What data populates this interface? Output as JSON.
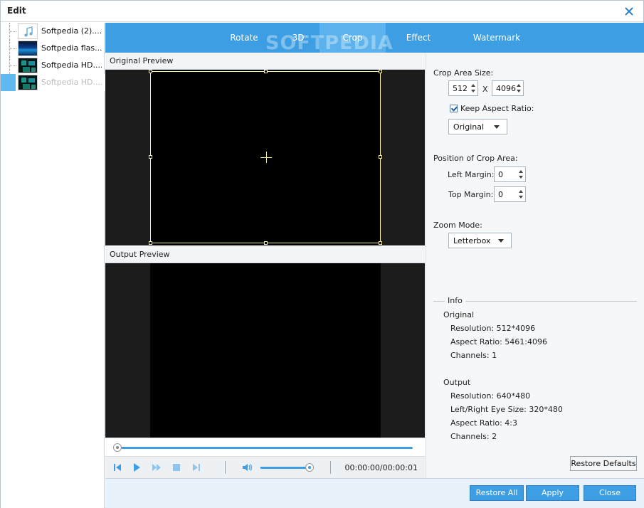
{
  "window": {
    "title": "Edit"
  },
  "files": [
    {
      "name": "Softpedia (2)....",
      "thumb": "music-note-icon"
    },
    {
      "name": "Softpedia flas...",
      "thumb": "flash-video-thumbnail"
    },
    {
      "name": "Softpedia HD....",
      "thumb": "hd-video-thumbnail"
    },
    {
      "name": "Softpedia HD....",
      "thumb": "hd-video-thumbnail",
      "selected": true
    }
  ],
  "tabs": [
    "Rotate",
    "3D",
    "Crop",
    "Effect",
    "Watermark"
  ],
  "active_tab": "Crop",
  "watermark_text": "SOFTPEDIA",
  "preview": {
    "original_label": "Original Preview",
    "output_label": "Output Preview"
  },
  "player": {
    "time": "00:00:00/00:00:01"
  },
  "crop": {
    "area_size_label": "Crop Area Size:",
    "width": "512",
    "x_label": "X",
    "height": "4096",
    "keep_aspect_label": "Keep Aspect Ratio:",
    "keep_aspect_checked": true,
    "aspect_value": "Original",
    "position_label": "Position of Crop Area:",
    "left_margin_label": "Left Margin:",
    "left_margin": "0",
    "top_margin_label": "Top Margin:",
    "top_margin": "0",
    "zoom_mode_label": "Zoom Mode:",
    "zoom_mode": "Letterbox"
  },
  "info": {
    "title": "Info",
    "original_label": "Original",
    "original_resolution": "Resolution: 512*4096",
    "original_aspect": "Aspect Ratio: 5461:4096",
    "original_channels": "Channels: 1",
    "output_label": "Output",
    "output_resolution": "Resolution: 640*480",
    "output_eye_size": "Left/Right Eye Size: 320*480",
    "output_aspect": "Aspect Ratio: 4:3",
    "output_channels": "Channels: 2"
  },
  "buttons": {
    "restore_defaults": "Restore Defaults",
    "restore_all": "Restore All",
    "apply": "Apply",
    "close": "Close"
  },
  "colors": {
    "accent": "#3d9ee3",
    "active_tab": "#5bb2ec",
    "crop_frame": "#f4f0a0"
  }
}
